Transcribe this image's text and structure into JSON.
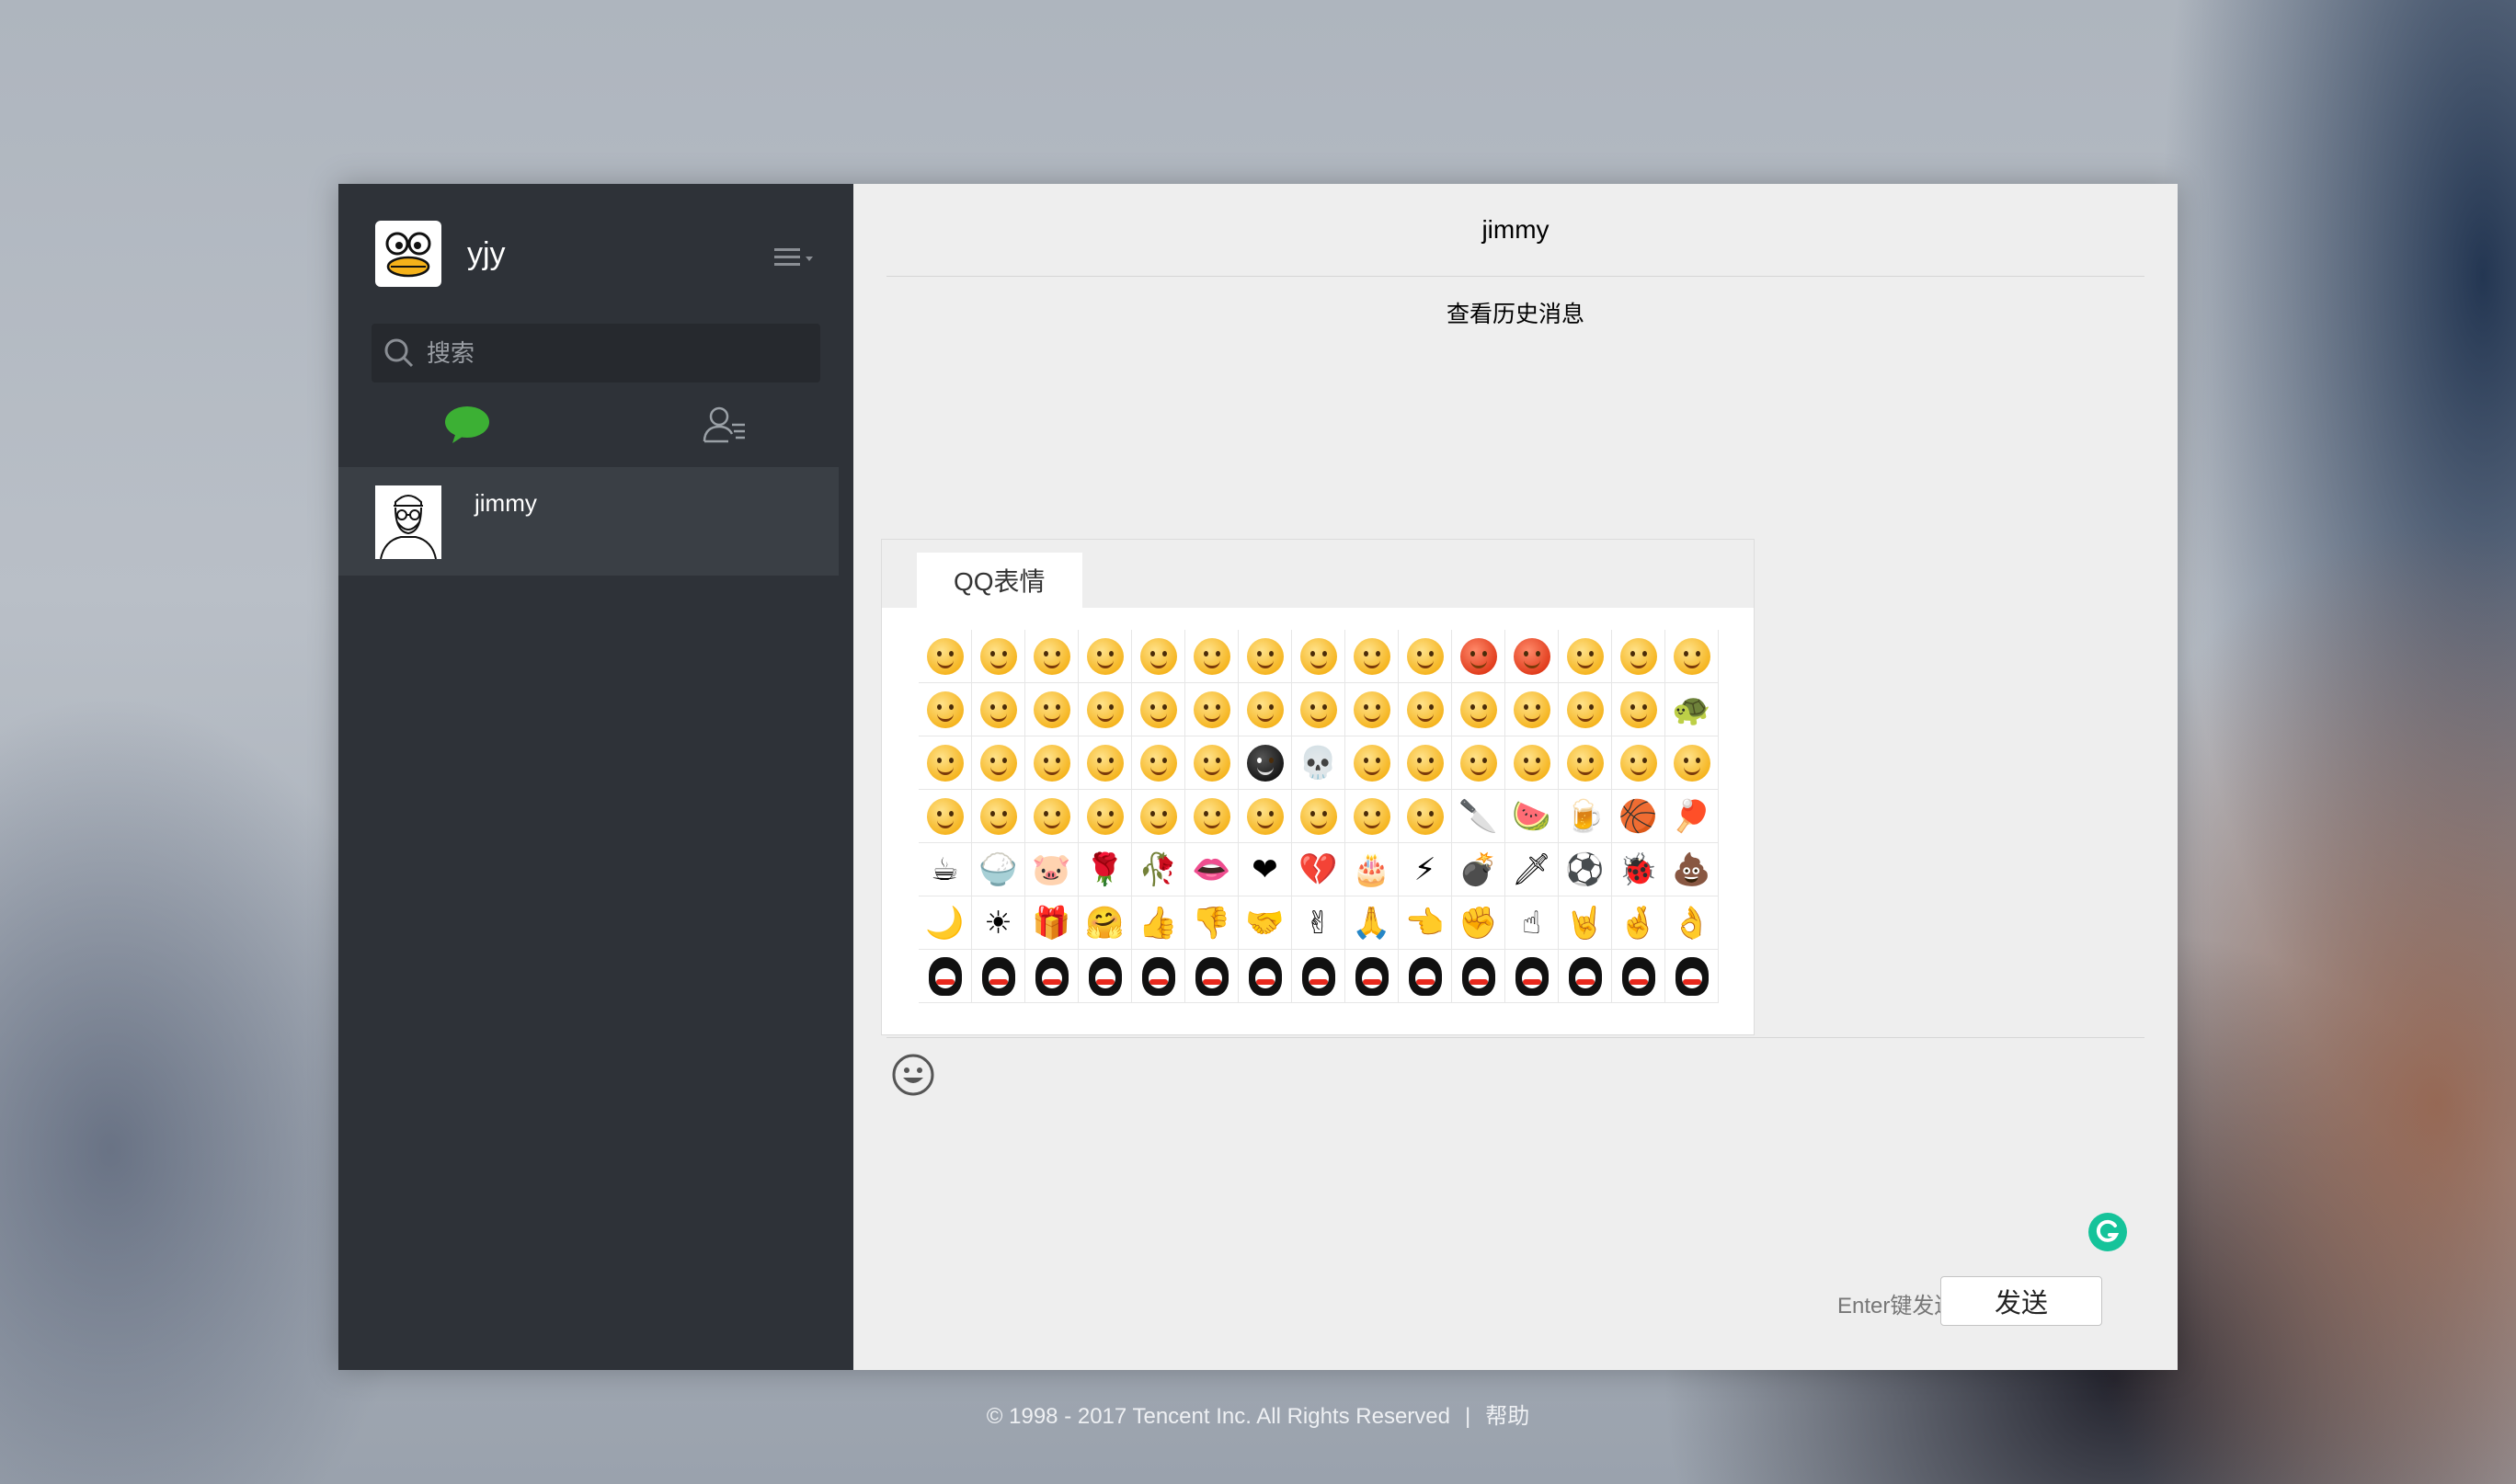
{
  "profile": {
    "name": "yjy"
  },
  "search": {
    "placeholder": "搜索"
  },
  "conversations": [
    {
      "name": "jimmy"
    }
  ],
  "chat": {
    "title": "jimmy",
    "history_link": "查看历史消息",
    "emoji_tab": "QQ表情",
    "enter_hint": "Enter键发送",
    "send_label": "发送"
  },
  "footer": {
    "copyright": "© 1998 - 2017 Tencent Inc. All Rights Reserved",
    "separator": "|",
    "help": "帮助"
  },
  "colors": {
    "sidebar": "#2e3238",
    "main": "#eeeeee",
    "accent_green": "#3cb034",
    "grammarly": "#15c39a"
  },
  "emoji_rows": [
    [
      "face",
      "face",
      "face",
      "face",
      "face",
      "face",
      "face",
      "face",
      "face",
      "face",
      "red",
      "red",
      "face",
      "face",
      "face"
    ],
    [
      "face",
      "face",
      "face",
      "face",
      "face",
      "face",
      "face",
      "face",
      "face",
      "face",
      "face",
      "face",
      "face",
      "face",
      "turtle"
    ],
    [
      "face",
      "face",
      "face",
      "face",
      "face",
      "face",
      "dark",
      "skull",
      "face",
      "face",
      "face",
      "face",
      "face",
      "face",
      "face"
    ],
    [
      "face",
      "face",
      "face",
      "face",
      "face",
      "face",
      "face",
      "face",
      "face",
      "face",
      "knife",
      "watermelon",
      "beer",
      "basketball",
      "pingpong"
    ],
    [
      "coffee",
      "rice",
      "pig",
      "rose",
      "wilted",
      "lips",
      "heart",
      "broken-heart",
      "cake",
      "lightning",
      "bomb",
      "dagger",
      "soccer",
      "ladybug",
      "poop"
    ],
    [
      "moon",
      "sun",
      "gift",
      "hug",
      "thumbs-up",
      "thumbs-down",
      "handshake",
      "victory",
      "fist-salute",
      "beckon",
      "fist",
      "pinky",
      "rock-on",
      "no",
      "ok"
    ],
    [
      "peng",
      "peng",
      "peng",
      "peng",
      "peng",
      "peng",
      "peng",
      "peng",
      "peng",
      "peng",
      "peng",
      "peng",
      "peng",
      "peng",
      "peng"
    ]
  ]
}
